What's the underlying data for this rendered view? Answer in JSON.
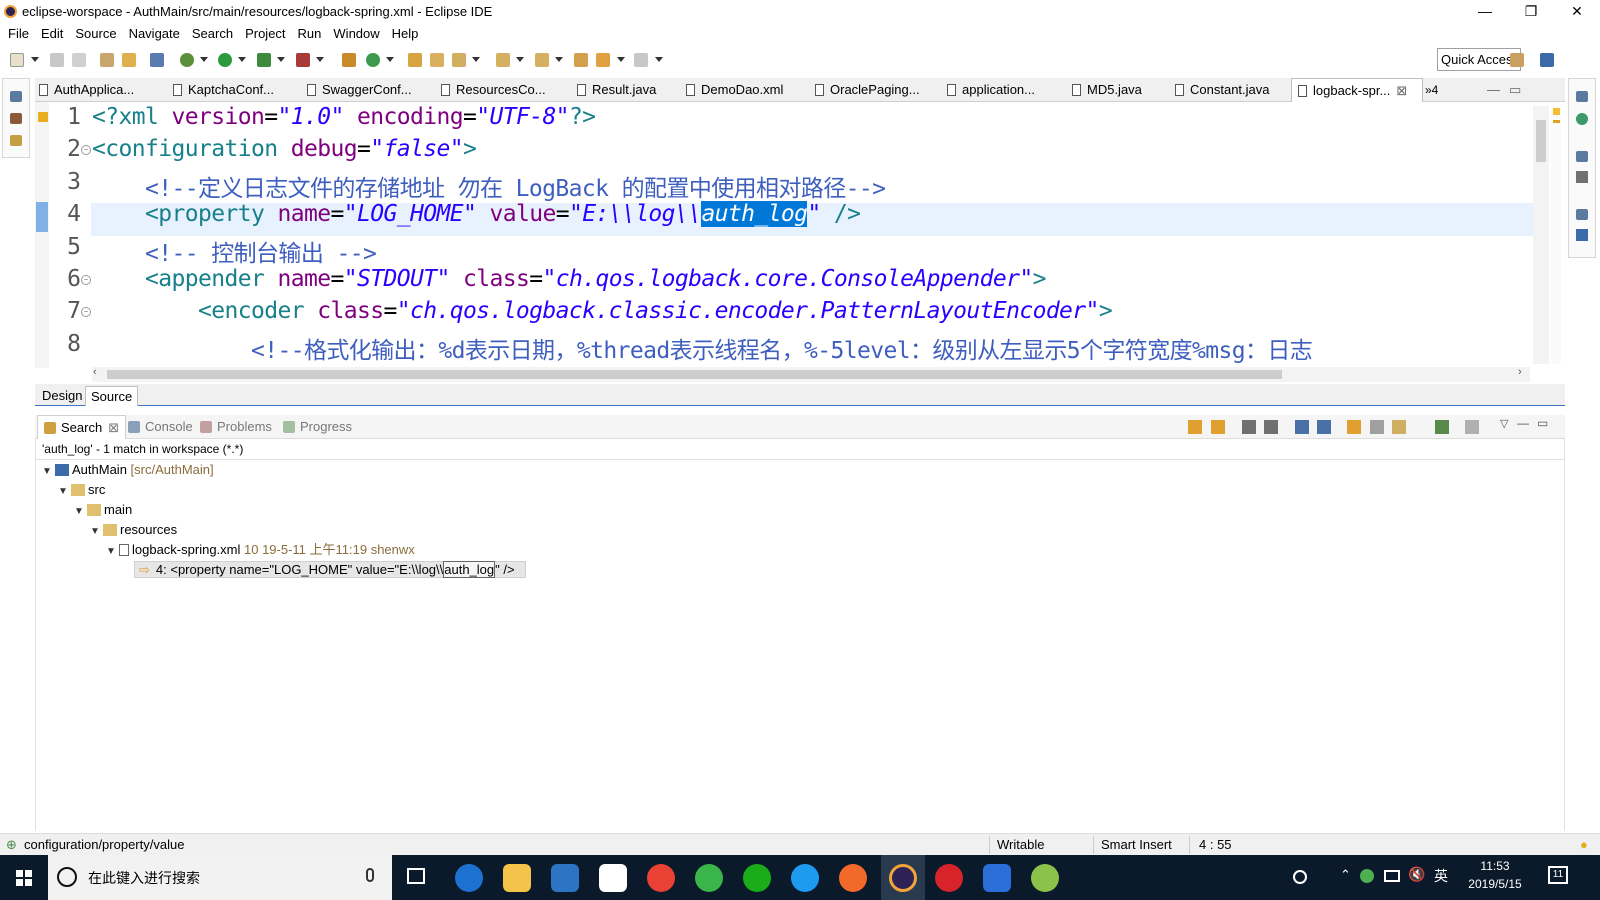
{
  "window": {
    "title": "eclipse-worspace - AuthMain/src/main/resources/logback-spring.xml - Eclipse IDE",
    "minimize": "—",
    "restore": "❐",
    "close": "✕"
  },
  "menu": [
    "File",
    "Edit",
    "Source",
    "Navigate",
    "Search",
    "Project",
    "Run",
    "Window",
    "Help"
  ],
  "toolbar": {
    "quick_access": "Quick Access"
  },
  "editor_tabs": [
    {
      "label": "AuthApplica...",
      "icon": "java-file-icon"
    },
    {
      "label": "KaptchaConf...",
      "icon": "java-file-icon"
    },
    {
      "label": "SwaggerConf...",
      "icon": "java-file-icon"
    },
    {
      "label": "ResourcesCo...",
      "icon": "java-file-icon"
    },
    {
      "label": "Result.java",
      "icon": "java-file-icon"
    },
    {
      "label": "DemoDao.xml",
      "icon": "xml-file-icon"
    },
    {
      "label": "OraclePaging...",
      "icon": "xml-file-icon"
    },
    {
      "label": "application...",
      "icon": "properties-file-icon"
    },
    {
      "label": "MD5.java",
      "icon": "java-file-icon"
    },
    {
      "label": "Constant.java",
      "icon": "java-file-icon"
    },
    {
      "label": "logback-spr...",
      "icon": "xml-file-icon",
      "active": true
    }
  ],
  "tab_overflow": "»4",
  "code": {
    "line_numbers": [
      "1",
      "2",
      "3",
      "4",
      "5",
      "6",
      "7",
      "8"
    ],
    "l1": {
      "a": "<?xml ",
      "b": "version",
      "c": "=",
      "d": "\"1.0\"",
      "e": " ",
      "f": "encoding",
      "g": "=",
      "h": "\"UTF-8\"",
      "i": "?>"
    },
    "l2": {
      "a": "<configuration ",
      "b": "debug",
      "c": "=",
      "d": "\"false\"",
      "e": ">"
    },
    "l3": {
      "a": "    <!--定义日志文件的存储地址 勿在 LogBack 的配置中使用相对路径-->"
    },
    "l4": {
      "a": "    <property ",
      "b": "name",
      "c": "=",
      "d": "\"LOG_HOME\"",
      "e": " ",
      "f": "value",
      "g": "=",
      "h": "\"E:\\\\log\\\\",
      "sel": "auth_log",
      "i": "\"",
      "j": " />"
    },
    "l5": {
      "a": "    <!-- 控制台输出 -->"
    },
    "l6": {
      "a": "    <appender ",
      "b": "name",
      "c": "=",
      "d": "\"STDOUT\"",
      "e": " ",
      "f": "class",
      "g": "=",
      "h": "\"ch.qos.logback.core.ConsoleAppender\"",
      "i": ">"
    },
    "l7": {
      "a": "        <encoder ",
      "b": "class",
      "c": "=",
      "d": "\"ch.qos.logback.classic.encoder.PatternLayoutEncoder\"",
      "e": ">"
    },
    "l8": {
      "a": "            <!--格式化输出：%d表示日期，%thread表示线程名，%-5level：级别从左显示5个字符宽度%msg：日志"
    }
  },
  "source_tabs": {
    "design": "Design",
    "source": "Source"
  },
  "panel_tabs": [
    {
      "label": "Search",
      "active": true
    },
    {
      "label": "Console"
    },
    {
      "label": "Problems"
    },
    {
      "label": "Progress"
    }
  ],
  "search": {
    "summary": "'auth_log' - 1 match in workspace (*.*)",
    "project": "AuthMain",
    "project_path": "[src/AuthMain]",
    "folder_src": "src",
    "folder_main": "main",
    "folder_resources": "resources",
    "file": "logback-spring.xml",
    "file_meta": "10  19-5-11 上午11:19  shenwx",
    "match_prefix": "4: <property name=\"LOG_HOME\" value=\"E:\\\\log\\\\",
    "match_hit": "auth_log",
    "match_suffix": "\" />"
  },
  "status": {
    "path": "configuration/property/value",
    "mode": "Writable",
    "insert": "Smart Insert",
    "position": "4 : 55"
  },
  "taskbar": {
    "search_placeholder": "在此键入进行搜索",
    "ime": "英",
    "time": "11:53",
    "date": "2019/5/15",
    "notifications": "11"
  },
  "colors": {
    "tag": "#17808a",
    "attribute": "#7f007f",
    "string": "#2a00ff",
    "comment": "#3f5fbf",
    "selection": "#0078d7",
    "taskbar": "#0b1a2a"
  }
}
